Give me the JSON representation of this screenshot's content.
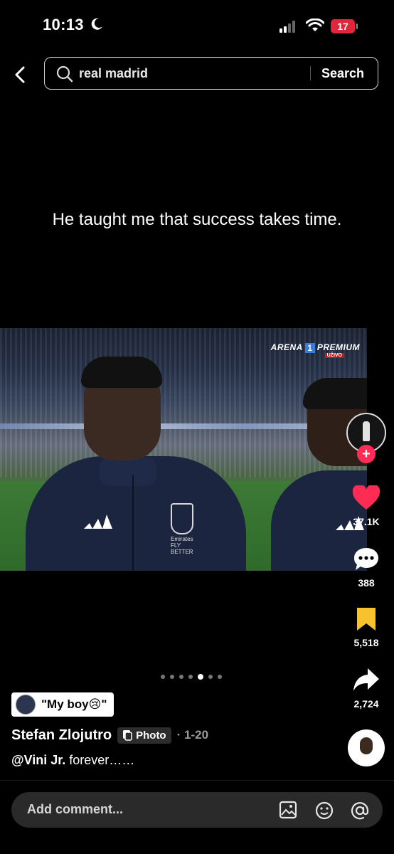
{
  "status_bar": {
    "time": "10:13",
    "battery": "17"
  },
  "search": {
    "query": "real madrid",
    "button_label": "Search"
  },
  "post": {
    "caption": "He taught me that success takes time.",
    "broadcast_logo": {
      "brand": "ARENA",
      "number": "1",
      "tier": "PREMIUM",
      "live": "UŽIVO"
    },
    "jersey_text": "Emirates\nFLY BETTER",
    "slides_total": 7,
    "slide_active": 5,
    "tag_label": "\"My boy😢\"",
    "username": "Stefan Zlojutro",
    "type_badge": "Photo",
    "date": "· 1-20",
    "mention": "@Vini Jr.",
    "description_rest": " forever……"
  },
  "actions": {
    "likes": "37.1K",
    "comments": "388",
    "saves": "5,518",
    "shares": "2,724"
  },
  "comment_bar": {
    "placeholder": "Add comment..."
  },
  "colors": {
    "like": "#fe2c55",
    "save": "#f8c22e",
    "battery": "#e0263a",
    "follow": "#fe2c55"
  }
}
